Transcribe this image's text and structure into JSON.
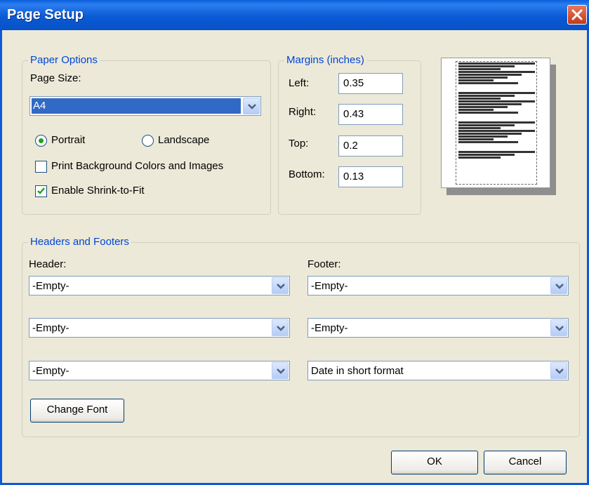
{
  "window": {
    "title": "Page Setup"
  },
  "paper_options": {
    "legend": "Paper Options",
    "page_size_label": "Page Size:",
    "page_size_value": "A4",
    "portrait_label": "Portrait",
    "landscape_label": "Landscape",
    "orientation": "portrait",
    "print_background_label": "Print Background Colors and Images",
    "print_background_checked": false,
    "shrink_label": "Enable Shrink-to-Fit",
    "shrink_checked": true
  },
  "margins": {
    "legend": "Margins (inches)",
    "left_label": "Left:",
    "left_value": "0.35",
    "right_label": "Right:",
    "right_value": "0.43",
    "top_label": "Top:",
    "top_value": "0.2",
    "bottom_label": "Bottom:",
    "bottom_value": "0.13"
  },
  "headers_footers": {
    "legend": "Headers and Footers",
    "header_label": "Header:",
    "footer_label": "Footer:",
    "header_values": [
      "-Empty-",
      "-Empty-",
      "-Empty-"
    ],
    "footer_values": [
      "-Empty-",
      "-Empty-",
      "Date in short format"
    ],
    "change_font_label": "Change Font"
  },
  "buttons": {
    "ok": "OK",
    "cancel": "Cancel"
  },
  "colors": {
    "title_bar": "#0A5BD5",
    "legend_text": "#0046D5",
    "dialog_bg": "#ECE9D8",
    "close_button": "#C4391A"
  }
}
